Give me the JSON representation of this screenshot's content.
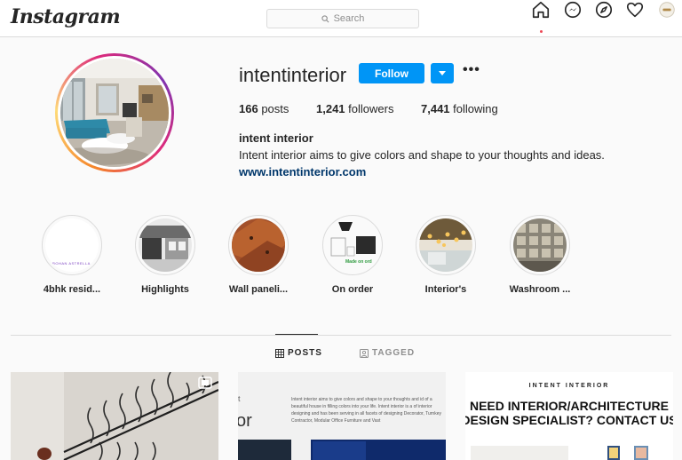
{
  "header": {
    "logo": "Instagram",
    "search_placeholder": "Search"
  },
  "profile": {
    "username": "intentinterior",
    "follow_label": "Follow",
    "more_label": "•••",
    "stats": {
      "posts_count": "166",
      "posts_label": " posts",
      "followers_count": "1,241",
      "followers_label": " followers",
      "following_count": "7,441",
      "following_label": " following"
    },
    "full_name": "intent interior",
    "bio": "Intent interior aims to give colors and shape to your thoughts and ideas.",
    "website": "www.intentinterior.com"
  },
  "highlights": [
    {
      "label": "4bhk resid...",
      "thumb_text": "ROHAN ASTRELLA"
    },
    {
      "label": "Highlights"
    },
    {
      "label": "Wall paneli..."
    },
    {
      "label": "On order",
      "thumb_text": "Made on ord"
    },
    {
      "label": "Interior's"
    },
    {
      "label": "Washroom ..."
    }
  ],
  "tabs": {
    "posts": "POSTS",
    "tagged": "TAGGED"
  },
  "posts": {
    "post2_text": "Intent interior aims to give colors and shape to your thoughts and id of a beautiful house in filling colors into your life. Intent interior is a of interior designing and has been serving in all facets of designing Decorator, Turnkey Contractor, Modular Office Furniture and Vast",
    "post2_big": "or",
    "post2_small": "t",
    "post3_brand": "INTENT  INTERIOR",
    "post3_heading": "NEED INTERIOR/ARCHITECTURE DESIGN SPECIALIST? CONTACT US"
  },
  "colors": {
    "accent": "#0095f6",
    "link": "#00376b",
    "notification": "#ed4956"
  }
}
